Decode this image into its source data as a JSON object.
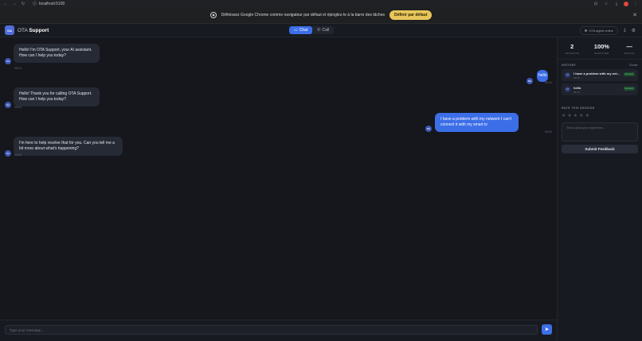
{
  "browser": {
    "url": "localhost:5100"
  },
  "infobar": {
    "message": "Définissez Google Chrome comme navigateur par défaut et épinglez-le à la barre des tâches",
    "button": "Définir par défaut"
  },
  "header": {
    "logo": "OA",
    "title_prefix": "OTA",
    "title": "Support",
    "tabs": [
      "Chat",
      "Call"
    ],
    "status": "OTA agent online"
  },
  "messages": [
    {
      "from": "bot",
      "avatar": "OA",
      "text": "Hello! I'm OTA Support, your AI assistant. How can I help you today?",
      "time": "09:14"
    },
    {
      "from": "user",
      "avatar": "ME",
      "text": "hello",
      "time": "09:14"
    },
    {
      "from": "bot",
      "avatar": "OA",
      "text": "Hello! Thank you for calling OTA Support. How can I help you today?",
      "time": "09:14"
    },
    {
      "from": "user",
      "avatar": "ME",
      "text": "I have a problem with my network I can't connect it with my smart tv",
      "time": "09:15"
    },
    {
      "from": "bot",
      "avatar": "OA",
      "text": "I'm here to help resolve that for you. Can you tell me a bit more about what's happening?",
      "time": "09:15"
    }
  ],
  "sidebar": {
    "stats": [
      {
        "value": "2",
        "label": "SESSIONS"
      },
      {
        "value": "100%",
        "label": "RESOLVED"
      },
      {
        "value": "—",
        "label": "RATING"
      }
    ],
    "history_label": "HISTORY",
    "history_action": "Clear",
    "history": [
      {
        "avatar": "OA",
        "title": "I have a problem with my net...",
        "sub": "09:15",
        "badge": "Resolved"
      },
      {
        "avatar": "OA",
        "title": "hello",
        "sub": "09:14",
        "badge": "Resolved"
      }
    ],
    "rate_label": "RATE THIS SESSION",
    "feedback_placeholder": "Tell us about your experience...",
    "submit": "Submit Feedback"
  },
  "composer": {
    "placeholder": "Type your message...",
    "send_icon": "send-icon"
  }
}
